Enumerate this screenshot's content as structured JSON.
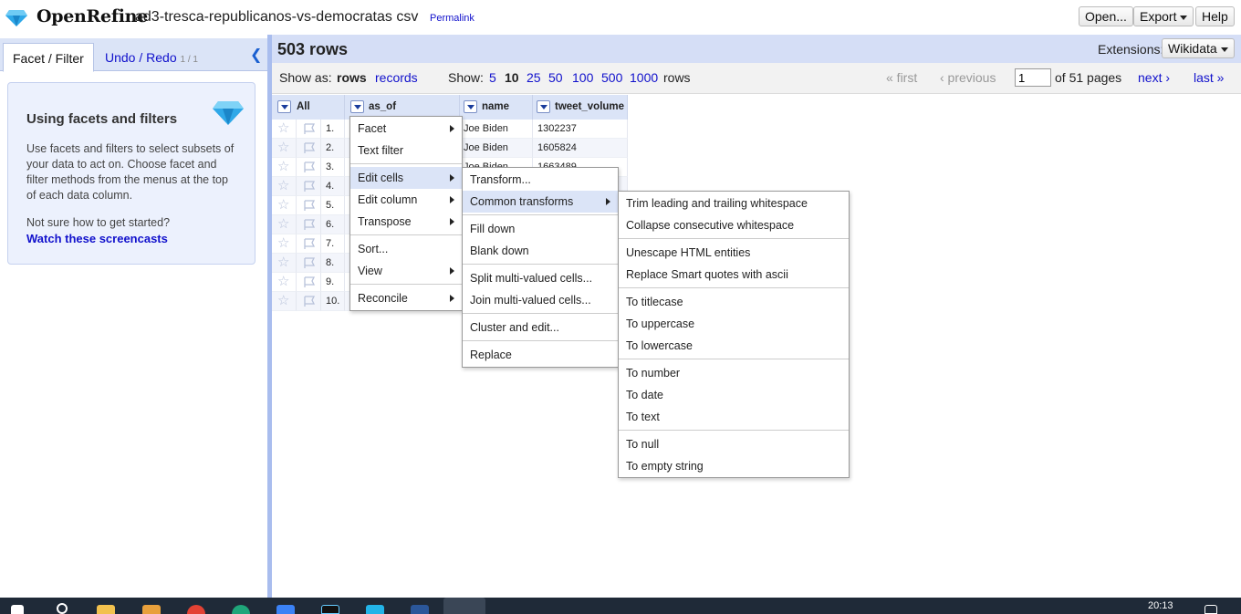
{
  "header": {
    "logo_text": "OpenRefine",
    "project_name": "ad3-tresca-republicanos-vs-democratas csv",
    "permalink": "Permalink",
    "buttons": {
      "open": "Open...",
      "export": "Export",
      "help": "Help"
    }
  },
  "left_panel": {
    "tabs": {
      "facet": "Facet / Filter",
      "undo": "Undo / Redo",
      "undo_count": "1 / 1"
    },
    "help": {
      "title": "Using facets and filters",
      "body": "Use facets and filters to select subsets of your data to act on. Choose facet and filter methods from the menus at the top of each data column.",
      "question": "Not sure how to get started?",
      "link": "Watch these screencasts"
    }
  },
  "summary": {
    "row_count": "503 rows",
    "extensions_label": "Extensions:",
    "extensions_button": "Wikidata"
  },
  "view_bar": {
    "show_as": "Show as:",
    "rows": "rows",
    "records": "records",
    "show": "Show:",
    "page_sizes": [
      "5",
      "10",
      "25",
      "50",
      "100",
      "500",
      "1000"
    ],
    "rows_suffix": "rows",
    "first": "« first",
    "previous": "‹ previous",
    "page_value": "1",
    "of_pages": "of 51 pages",
    "next": "next ›",
    "last": "last »"
  },
  "table": {
    "columns": [
      "All",
      "as_of",
      "name",
      "tweet_volume"
    ],
    "rows": [
      {
        "n": "1.",
        "name": "Joe Biden",
        "volume": "1302237"
      },
      {
        "n": "2.",
        "name": "Joe Biden",
        "volume": "1605824"
      },
      {
        "n": "3.",
        "name": "Joe Biden",
        "volume": "1663489"
      },
      {
        "n": "4.",
        "name": "",
        "volume": ""
      },
      {
        "n": "5.",
        "name": "",
        "volume": ""
      },
      {
        "n": "6.",
        "name": "",
        "volume": ""
      },
      {
        "n": "7.",
        "name": "",
        "volume": ""
      },
      {
        "n": "8.",
        "name": "",
        "volume": ""
      },
      {
        "n": "9.",
        "name": "",
        "volume": ""
      },
      {
        "n": "10.",
        "name": "",
        "volume": ""
      }
    ]
  },
  "column_menu": [
    "Facet",
    "Text filter",
    "Edit cells",
    "Edit column",
    "Transpose",
    "Sort...",
    "View",
    "Reconcile"
  ],
  "edit_cells_menu": [
    "Transform...",
    "Common transforms",
    "Fill down",
    "Blank down",
    "Split multi-valued cells...",
    "Join multi-valued cells...",
    "Cluster and edit...",
    "Replace"
  ],
  "common_transforms_menu": [
    "Trim leading and trailing whitespace",
    "Collapse consecutive whitespace",
    "Unescape HTML entities",
    "Replace Smart quotes with ascii",
    "To titlecase",
    "To uppercase",
    "To lowercase",
    "To number",
    "To date",
    "To text",
    "To null",
    "To empty string"
  ],
  "taskbar": {
    "clock": "20:13"
  },
  "colors": {
    "accent": "#11c",
    "header_blue": "#dbe4f7",
    "splitter": "#a9bdee"
  }
}
